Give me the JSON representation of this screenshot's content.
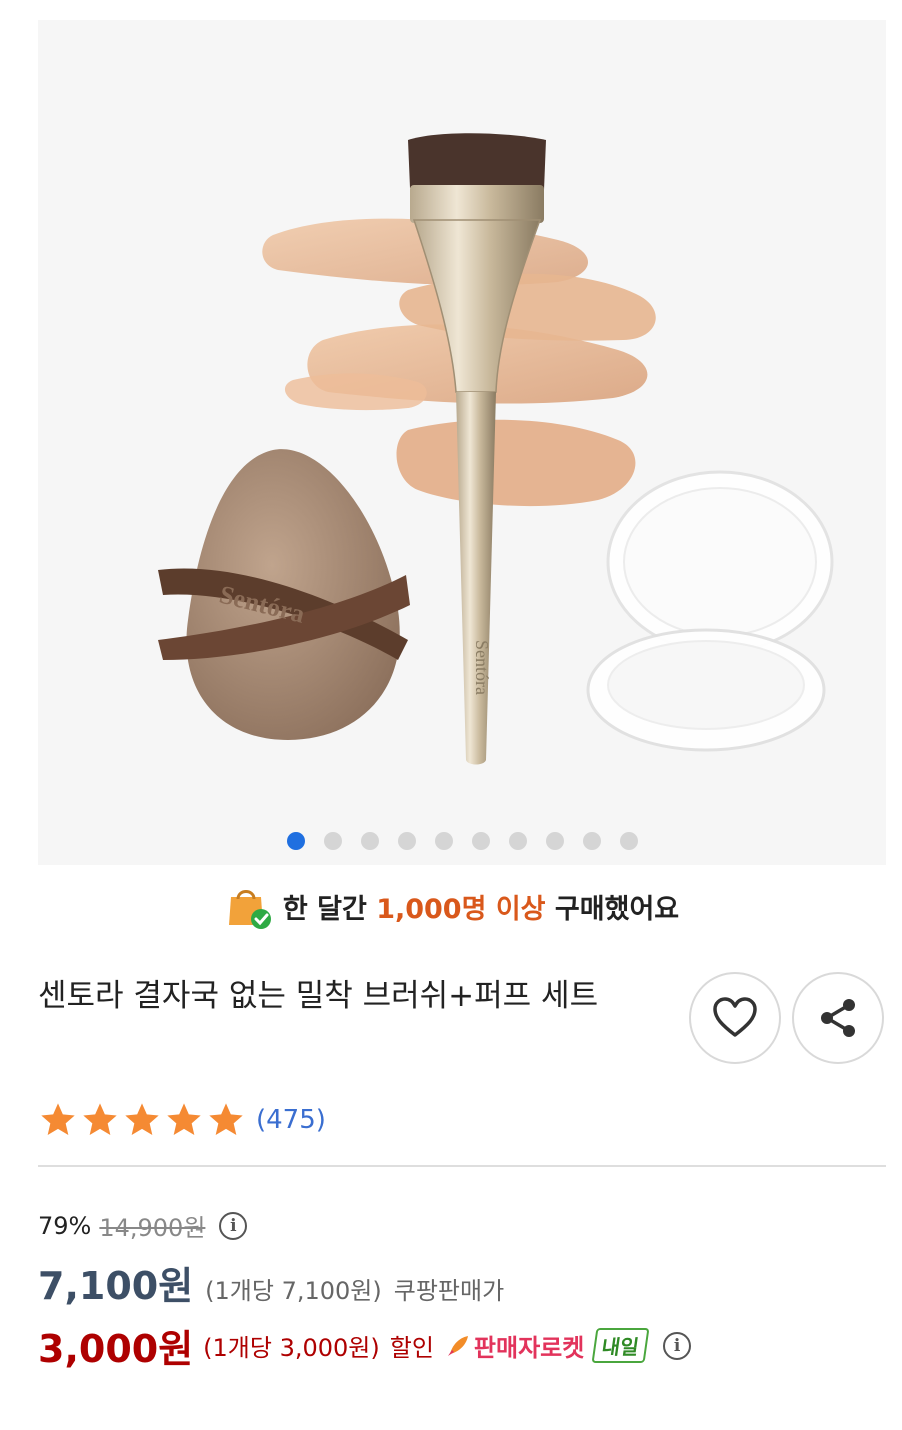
{
  "gallery": {
    "brand_on_puff": "Sentóra",
    "brand_on_brush": "Sentóra",
    "slide_count": 10,
    "active_index": 0
  },
  "banner": {
    "prefix": "한 달간",
    "highlight": "1,000명 이상",
    "suffix": "구매했어요",
    "icon": "shopping-bag-check-icon"
  },
  "product": {
    "title": "센토라 결자국 없는 밀착 브러쉬+퍼프 세트"
  },
  "actions": {
    "like_icon": "heart-icon",
    "share_icon": "share-icon"
  },
  "rating": {
    "stars": 5,
    "review_count": "(475)",
    "star_color": "#f58a33"
  },
  "pricing": {
    "discount_rate": "79%",
    "original_price": "14,900원",
    "sale_price": "7,100원",
    "sale_unit_price": "(1개당 7,100원)",
    "sale_label": "쿠팡판매가",
    "coupon_price": "3,000원",
    "coupon_unit_price": "(1개당 3,000원)",
    "coupon_label": "할인",
    "rocket_label": "판매자로켓",
    "delivery_badge": "내일"
  },
  "colors": {
    "accent_blue": "#1f6fe0",
    "highlight_orange": "#d9581b",
    "price_red": "#ae0000"
  }
}
